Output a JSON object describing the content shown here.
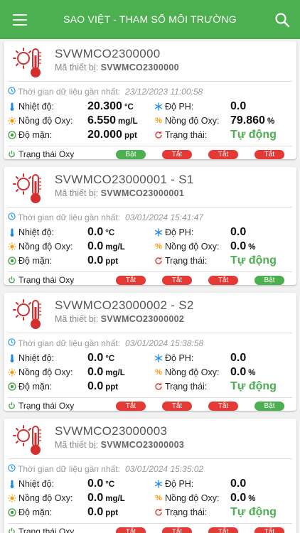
{
  "appbar": {
    "title": "SAO VIỆT - THAM SỐ MÔI TRƯỜNG",
    "icons": [
      "menu-icon",
      "search-icon"
    ],
    "background": "#4caf50"
  },
  "labels": {
    "device_id": "Mã thiết bị:",
    "last_data_time": "Thời gian dữ liệu gần nhất:",
    "temperature": "Nhiệt độ:",
    "oxygen": "Nồng độ Oxy:",
    "salinity": "Độ mặn:",
    "ph": "Độ PH:",
    "oxygen_pct": "Nồng độ Oxy:",
    "status": "Trạng thái:",
    "oxy_state": "Trạng thái Oxy",
    "unit_temp": "°C",
    "unit_oxy": "mg/L",
    "unit_sal": "ppt",
    "unit_pct": "%"
  },
  "colors": {
    "on": "#4caf50",
    "off": "#e53935",
    "mode": "#4caf50"
  },
  "devices": [
    {
      "name": "SVWMCO2300000",
      "device_id": "SVWMCO2300000",
      "time": "23/12/2023 11:00:58",
      "temperature": "20.300",
      "oxygen": "6.550",
      "salinity": "20.000",
      "ph": "0.0",
      "oxygen_pct": "79.860",
      "mode": "Tự động",
      "switches": [
        {
          "label": "Bật",
          "on": true
        },
        {
          "label": "Tắt",
          "on": false
        },
        {
          "label": "Tắt",
          "on": false
        },
        {
          "label": "Tắt",
          "on": false
        }
      ]
    },
    {
      "name": "SVWMCO23000001 - S1",
      "device_id": "SVWMCO23000001",
      "time": "03/01/2024 15:41:47",
      "temperature": "0.0",
      "oxygen": "0.0",
      "salinity": "0.0",
      "ph": "0.0",
      "oxygen_pct": "0.0",
      "mode": "Tự động",
      "switches": [
        {
          "label": "Tắt",
          "on": false
        },
        {
          "label": "Tắt",
          "on": false
        },
        {
          "label": "Tắt",
          "on": false
        },
        {
          "label": "Bật",
          "on": true
        }
      ]
    },
    {
      "name": "SVWMCO23000002 - S2",
      "device_id": "SVWMCO23000002",
      "time": "03/01/2024 15:38:58",
      "temperature": "0.0",
      "oxygen": "0.0",
      "salinity": "0.0",
      "ph": "0.0",
      "oxygen_pct": "0.0",
      "mode": "Tự động",
      "switches": [
        {
          "label": "Tắt",
          "on": false
        },
        {
          "label": "Tắt",
          "on": false
        },
        {
          "label": "Tắt",
          "on": false
        },
        {
          "label": "Bật",
          "on": true
        }
      ]
    },
    {
      "name": "SVWMCO23000003",
      "device_id": "SVWMCO23000003",
      "time": "03/01/2024 15:35:02",
      "temperature": "0.0",
      "oxygen": "0.0",
      "salinity": "0.0",
      "ph": "0.0",
      "oxygen_pct": "0.0",
      "mode": "Tự động",
      "switches": [
        {
          "label": "Tắt",
          "on": false
        },
        {
          "label": "Tắt",
          "on": false
        },
        {
          "label": "Tắt",
          "on": false
        },
        {
          "label": "Tắt",
          "on": false
        }
      ]
    }
  ]
}
